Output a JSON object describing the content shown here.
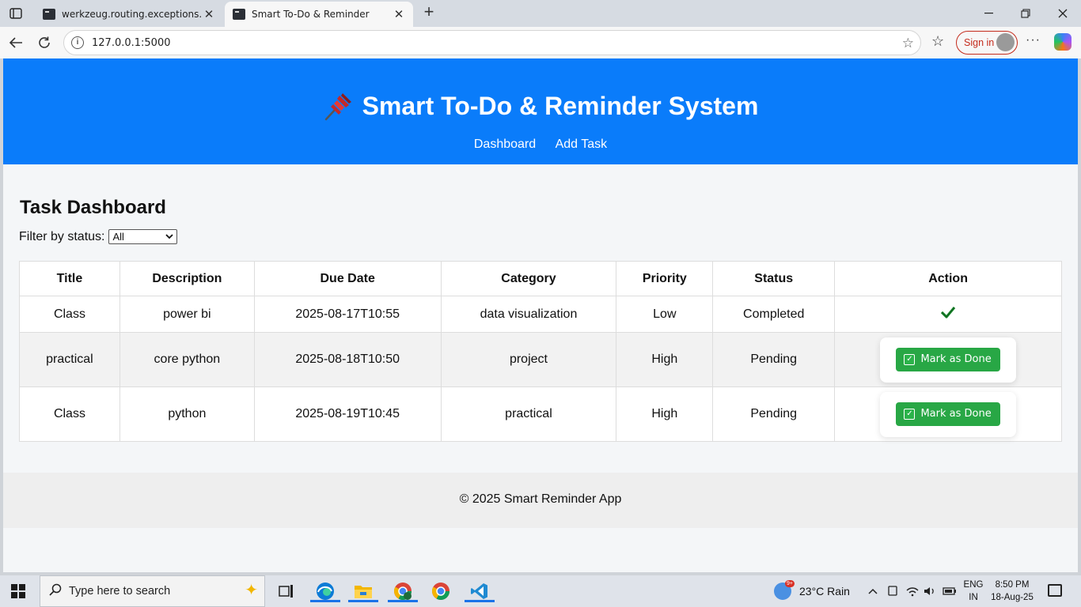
{
  "browser": {
    "tabs": [
      {
        "title": "werkzeug.routing.exceptions.BuildError",
        "active": false
      },
      {
        "title": "Smart To-Do & Reminder",
        "active": true
      }
    ],
    "url": "127.0.0.1:5000",
    "signin_label": "Sign in"
  },
  "app": {
    "title": "Smart To-Do & Reminder System",
    "nav": [
      "Dashboard",
      "Add Task"
    ],
    "accent_color": "#0a7cfa"
  },
  "dashboard": {
    "heading": "Task Dashboard",
    "filter_label": "Filter by status:",
    "filter_value": "All",
    "columns": [
      "Title",
      "Description",
      "Due Date",
      "Category",
      "Priority",
      "Status",
      "Action"
    ],
    "rows": [
      {
        "title": "Class",
        "description": "power bi",
        "due": "2025-08-17T10:55",
        "category": "data visualization",
        "priority": "Low",
        "status": "Completed",
        "action": "check-icon"
      },
      {
        "title": "practical",
        "description": "core python",
        "due": "2025-08-18T10:50",
        "category": "project",
        "priority": "High",
        "status": "Pending",
        "action": "Mark as Done"
      },
      {
        "title": "Class",
        "description": "python",
        "due": "2025-08-19T10:45",
        "category": "practical",
        "priority": "High",
        "status": "Pending",
        "action": "Mark as Done"
      }
    ],
    "done_button_color": "#28a745"
  },
  "footer": {
    "text": "© 2025 Smart Reminder App"
  },
  "taskbar": {
    "search_placeholder": "Type here to search",
    "weather": "23°C  Rain",
    "weather_badge": "9+",
    "lang_top": "ENG",
    "lang_bottom": "IN",
    "time": "8:50 PM",
    "date": "18-Aug-25"
  }
}
